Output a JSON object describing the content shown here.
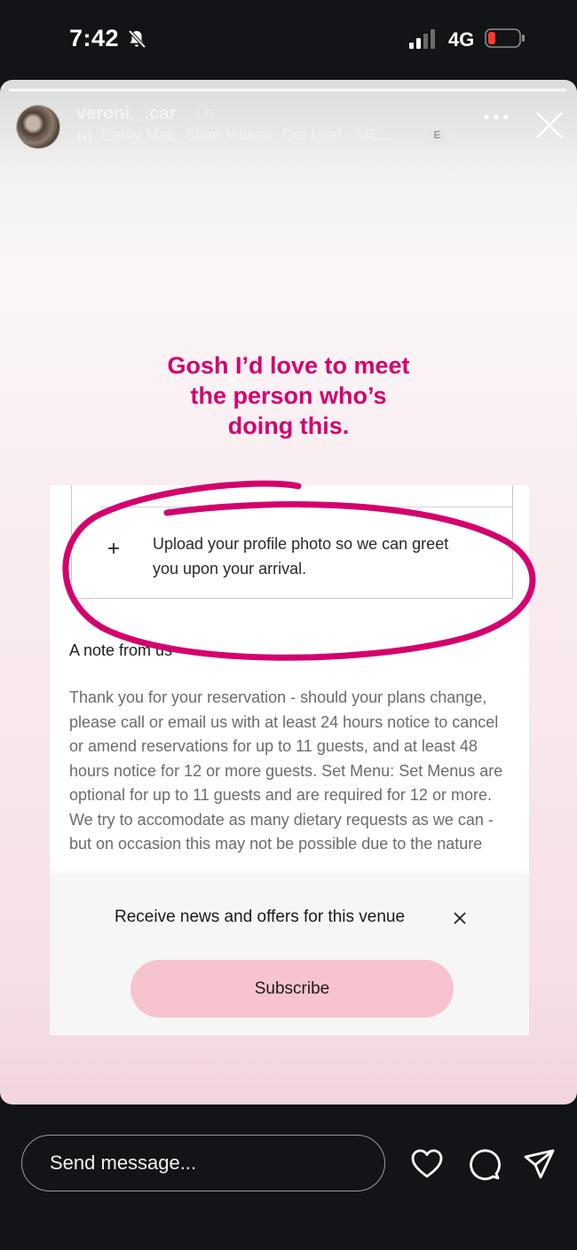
{
  "status_bar": {
    "time": "7:42",
    "network": "4G",
    "battery_color": "#ff3b30"
  },
  "story": {
    "username": "veroni._.car",
    "age": "1h",
    "music": "Earlly Mac, Slum Village, Dej Loaf · ME...",
    "explicit_badge": "E",
    "chevron": "›",
    "headline_lines": [
      "Gosh I’d love to meet",
      "the person who’s",
      "doing this."
    ],
    "accent_color": "#d4006d"
  },
  "screenshot": {
    "upload_plus": "+",
    "upload_text": "Upload your profile photo so we can greet you upon your arrival.",
    "note_heading": "A note from us",
    "note_body": "Thank you for your reservation - should your plans change, please call or email us with at least 24 hours notice to cancel or amend reservations for up to 11 guests, and at least 48 hours notice for 12 or more guests. Set Menu: Set Menus are optional for up to 11 guests and are required for 12 or more. We try to accomodate as many dietary requests as we can - but on occasion this may not be possible due to the nature",
    "news_text": "Receive news and offers for this venue",
    "subscribe_label": "Subscribe",
    "subscribe_color": "#f7c3cf"
  },
  "bottom_bar": {
    "message_placeholder": "Send message...",
    "icons": [
      "heart-icon",
      "comment-icon",
      "send-icon"
    ]
  }
}
